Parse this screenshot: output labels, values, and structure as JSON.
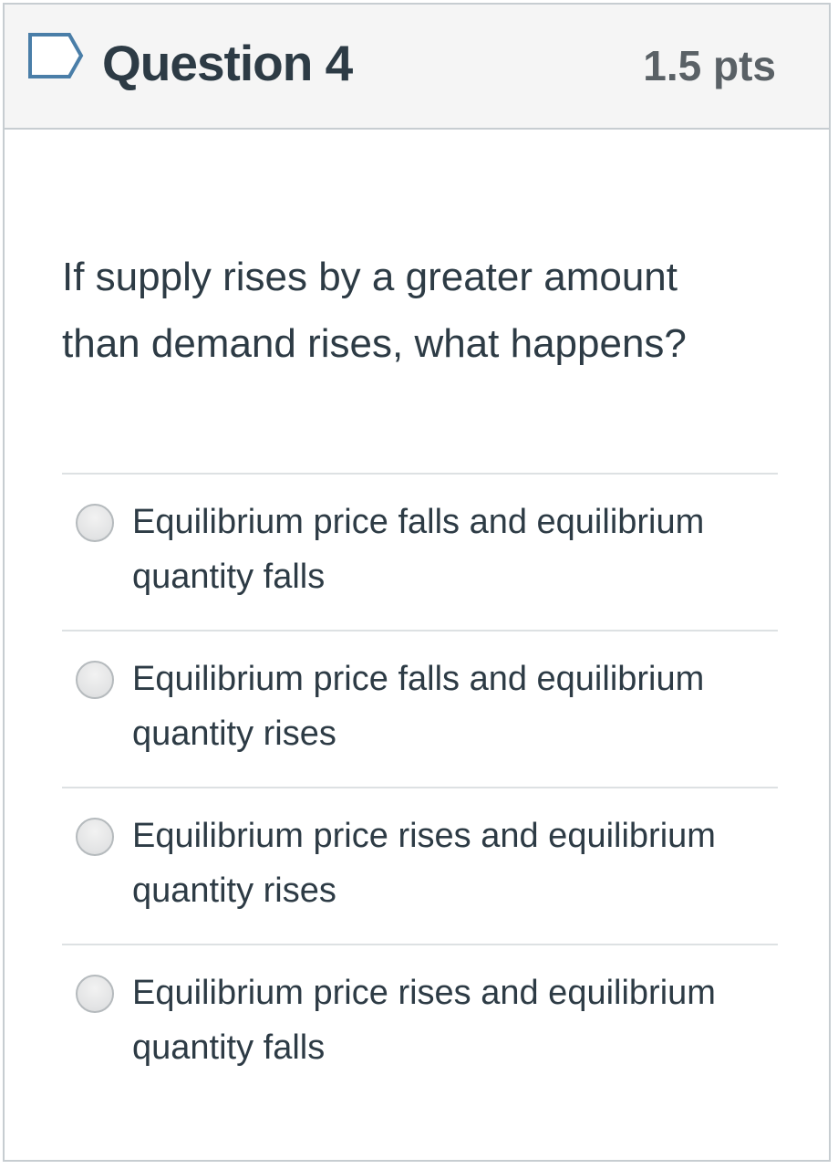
{
  "question": {
    "title": "Question 4",
    "points": "1.5 pts",
    "text": "If supply rises by a greater amount than demand rises, what happens?",
    "flag_icon": "flag-outline-icon"
  },
  "answers": [
    {
      "label": "Equilibrium price falls and equilibrium quantity falls",
      "selected": false
    },
    {
      "label": "Equilibrium price falls and equilibrium quantity rises",
      "selected": false
    },
    {
      "label": "Equilibrium price rises and equilibrium quantity rises",
      "selected": false
    },
    {
      "label": "Equilibrium price rises and equilibrium quantity falls",
      "selected": false
    }
  ],
  "colors": {
    "text": "#2d3b45",
    "points": "#5a6166",
    "header_bg": "#f5f5f5",
    "border": "#c7cdd1",
    "flag": "#4a7ea8"
  }
}
